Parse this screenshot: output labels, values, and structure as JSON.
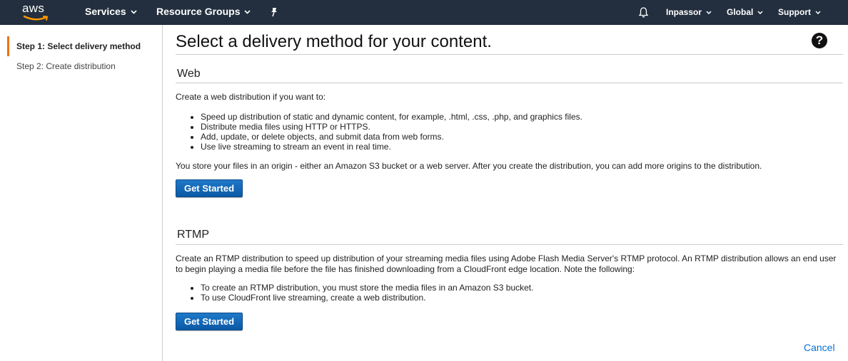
{
  "topnav": {
    "logo_text": "aws",
    "services": "Services",
    "resource_groups": "Resource Groups",
    "user": "Inpassor",
    "region": "Global",
    "support": "Support"
  },
  "sidebar": {
    "steps": [
      {
        "label": "Step 1: Select delivery method",
        "active": true
      },
      {
        "label": "Step 2: Create distribution",
        "active": false
      }
    ]
  },
  "main": {
    "title": "Select a delivery method for your content.",
    "help": "?",
    "web": {
      "heading": "Web",
      "intro": "Create a web distribution if you want to:",
      "bullets": [
        "Speed up distribution of static and dynamic content, for example, .html, .css, .php, and graphics files.",
        "Distribute media files using HTTP or HTTPS.",
        "Add, update, or delete objects, and submit data from web forms.",
        "Use live streaming to stream an event in real time."
      ],
      "note": "You store your files in an origin - either an Amazon S3 bucket or a web server. After you create the distribution, you can add more origins to the distribution.",
      "button": "Get Started"
    },
    "rtmp": {
      "heading": "RTMP",
      "intro": "Create an RTMP distribution to speed up distribution of your streaming media files using Adobe Flash Media Server's RTMP protocol. An RTMP distribution allows an end user to begin playing a media file before the file has finished downloading from a CloudFront edge location. Note the following:",
      "bullets": [
        "To create an RTMP distribution, you must store the media files in an Amazon S3 bucket.",
        "To use CloudFront live streaming, create a web distribution."
      ],
      "button": "Get Started"
    },
    "cancel": "Cancel"
  },
  "colors": {
    "topbar": "#232f3e",
    "active_step_border": "#ec7211",
    "button": "#0b59a5",
    "link": "#0972d3"
  }
}
